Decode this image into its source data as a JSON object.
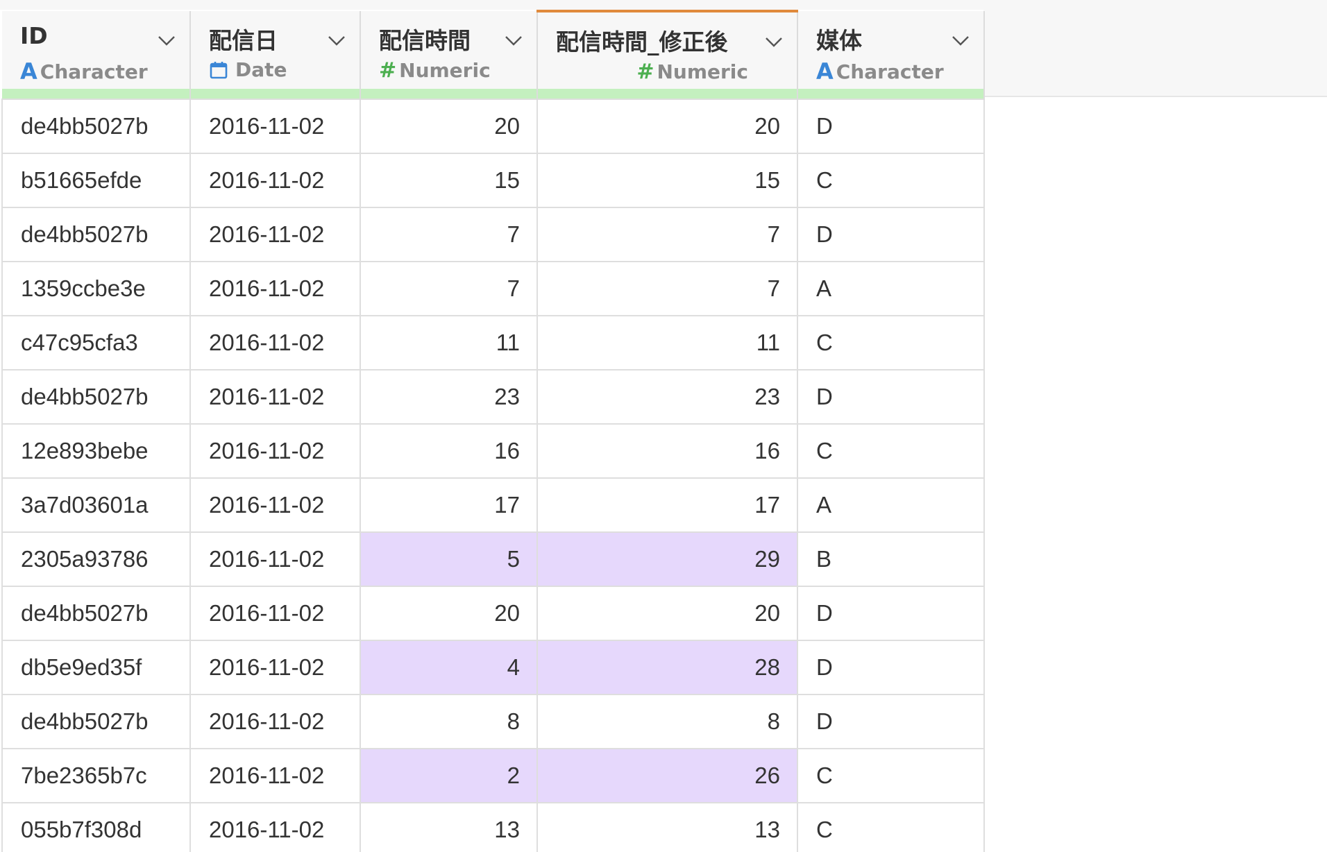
{
  "columns": [
    {
      "name": "ID",
      "type_label": "Character",
      "type_icon": "character-icon",
      "align": "left",
      "selected": false
    },
    {
      "name": "配信日",
      "type_label": "Date",
      "type_icon": "calendar-icon",
      "align": "left",
      "selected": false
    },
    {
      "name": "配信時間",
      "type_label": "Numeric",
      "type_icon": "numeric-icon",
      "align": "right",
      "selected": false
    },
    {
      "name": "配信時間_修正後",
      "type_label": "Numeric",
      "type_icon": "numeric-icon",
      "align": "right",
      "selected": true
    },
    {
      "name": "媒体",
      "type_label": "Character",
      "type_icon": "character-icon",
      "align": "left",
      "selected": false
    }
  ],
  "icons": {
    "character_glyph": "A",
    "numeric_glyph": "#"
  },
  "colors": {
    "character_icon": "#3a86d6",
    "numeric_icon": "#4caf50",
    "date_icon": "#3a86d6",
    "quality_bar": "#c4f0bf",
    "selected_column_accent": "#e08a3c",
    "highlight_cell": "#e6d8fc"
  },
  "rows": [
    {
      "cells": [
        "de4bb5027b",
        "2016-11-02",
        "20",
        "20",
        "D"
      ],
      "highlighted": false
    },
    {
      "cells": [
        "b51665efde",
        "2016-11-02",
        "15",
        "15",
        "C"
      ],
      "highlighted": false
    },
    {
      "cells": [
        "de4bb5027b",
        "2016-11-02",
        "7",
        "7",
        "D"
      ],
      "highlighted": false
    },
    {
      "cells": [
        "1359ccbe3e",
        "2016-11-02",
        "7",
        "7",
        "A"
      ],
      "highlighted": false
    },
    {
      "cells": [
        "c47c95cfa3",
        "2016-11-02",
        "11",
        "11",
        "C"
      ],
      "highlighted": false
    },
    {
      "cells": [
        "de4bb5027b",
        "2016-11-02",
        "23",
        "23",
        "D"
      ],
      "highlighted": false
    },
    {
      "cells": [
        "12e893bebe",
        "2016-11-02",
        "16",
        "16",
        "C"
      ],
      "highlighted": false
    },
    {
      "cells": [
        "3a7d03601a",
        "2016-11-02",
        "17",
        "17",
        "A"
      ],
      "highlighted": false
    },
    {
      "cells": [
        "2305a93786",
        "2016-11-02",
        "5",
        "29",
        "B"
      ],
      "highlighted": true
    },
    {
      "cells": [
        "de4bb5027b",
        "2016-11-02",
        "20",
        "20",
        "D"
      ],
      "highlighted": false
    },
    {
      "cells": [
        "db5e9ed35f",
        "2016-11-02",
        "4",
        "28",
        "D"
      ],
      "highlighted": true
    },
    {
      "cells": [
        "de4bb5027b",
        "2016-11-02",
        "8",
        "8",
        "D"
      ],
      "highlighted": false
    },
    {
      "cells": [
        "7be2365b7c",
        "2016-11-02",
        "2",
        "26",
        "C"
      ],
      "highlighted": true
    },
    {
      "cells": [
        "055b7f308d",
        "2016-11-02",
        "13",
        "13",
        "C"
      ],
      "highlighted": false
    }
  ]
}
